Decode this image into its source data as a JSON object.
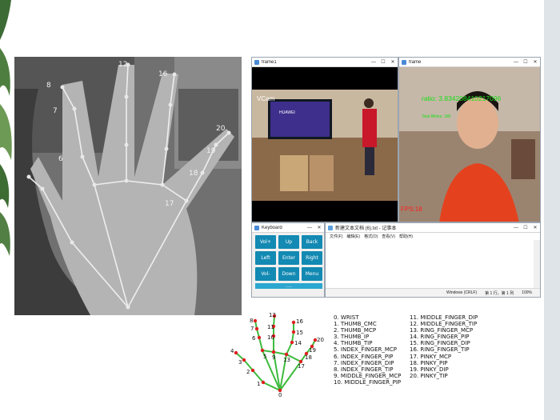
{
  "hand_photo": {
    "landmark_labels": [
      "8",
      "7",
      "6",
      "12",
      "16",
      "20",
      "19",
      "18",
      "17"
    ]
  },
  "frame1": {
    "title": "frame1",
    "overlay_text": "VCam",
    "tv_brand": "HUAWEI"
  },
  "frame2": {
    "title": "frame",
    "ratio_text": "ratio: 3.834208410217096",
    "blinks_text": "Total Blinks: 180",
    "fps_text": "FPS:18"
  },
  "keyboard": {
    "title": "Keyboard",
    "keys": [
      "Vol+",
      "Up",
      "Back",
      "Left",
      "Enter",
      "Right",
      "Vol-",
      "Down",
      "Menu"
    ],
    "bar_label": "------"
  },
  "notepad": {
    "title": "新建文本文档 (6).txt - 记事本",
    "menu": [
      "文件(F)",
      "编辑(E)",
      "格式(O)",
      "查看(V)",
      "帮助(H)"
    ],
    "status": [
      "Windows (CRLF)",
      "第 1 行，第 1 列",
      "100%"
    ]
  },
  "diagram": {
    "point_labels": [
      "0",
      "1",
      "2",
      "3",
      "4",
      "5",
      "6",
      "7",
      "8",
      "9",
      "10",
      "11",
      "12",
      "13",
      "14",
      "15",
      "16",
      "17",
      "18",
      "19",
      "20"
    ],
    "legend_left": [
      "0. WRIST",
      "1. THUMB_CMC",
      "2. THUMB_MCP",
      "3. THUMB_IP",
      "4. THUMB_TIP",
      "5. INDEX_FINGER_MCP",
      "6. INDEX_FINGER_PIP",
      "7. INDEX_FINGER_DIP",
      "8. INDEX_FINGER_TIP",
      "9. MIDDLE_FINGER_MCP",
      "10. MIDDLE_FINGER_PIP"
    ],
    "legend_right": [
      "11. MIDDLE_FINGER_DIP",
      "12. MIDDLE_FINGER_TIP",
      "13. RING_FINGER_MCP",
      "14. RING_FINGER_PIP",
      "15. RING_FINGER_DIP",
      "16. RING_FINGER_TIP",
      "17. PINKY_MCP",
      "18. PINKY_PIP",
      "19. PINKY_DIP",
      "20. PINKY_TIP"
    ]
  },
  "colors": {
    "landmark_point": "#e02020",
    "landmark_line": "#3dbb3d",
    "overlay_green": "#18e018",
    "overlay_red": "#ff2020",
    "key_blue": "#138ab3"
  }
}
